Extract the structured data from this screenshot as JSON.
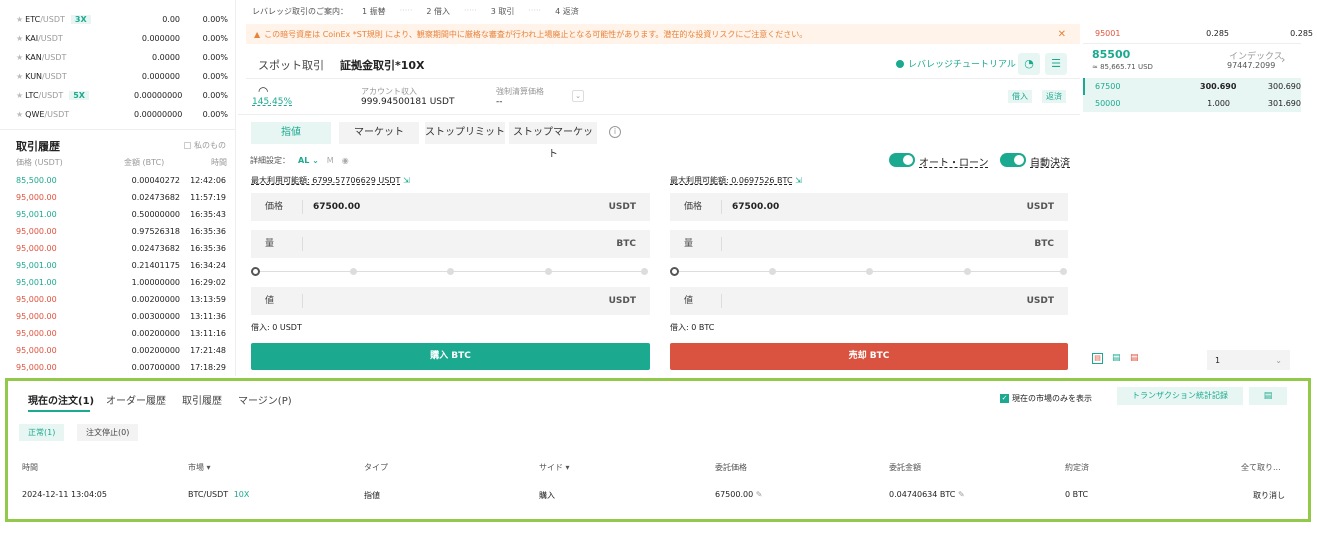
{
  "markets": [
    {
      "name": "ETC",
      "quote": "/USDT",
      "lev": "3X",
      "price": "0.00",
      "change": "0.00%"
    },
    {
      "name": "KAI",
      "quote": "/USDT",
      "lev": "",
      "price": "0.000000",
      "change": "0.00%"
    },
    {
      "name": "KAN",
      "quote": "/USDT",
      "lev": "",
      "price": "0.0000",
      "change": "0.00%"
    },
    {
      "name": "KUN",
      "quote": "/USDT",
      "lev": "",
      "price": "0.000000",
      "change": "0.00%"
    },
    {
      "name": "LTC",
      "quote": "/USDT",
      "lev": "5X",
      "price": "0.00000000",
      "change": "0.00%"
    },
    {
      "name": "QWE",
      "quote": "/USDT",
      "lev": "",
      "price": "0.00000000",
      "change": "0.00%"
    }
  ],
  "trade_history": {
    "title": "取引履歴",
    "mine": "私のもの",
    "h_price": "価格 (USDT)",
    "h_amount": "金額 (BTC)",
    "h_time": "時間",
    "rows": [
      {
        "p": "85,500.00",
        "a": "0.00040272",
        "t": "12:42:06",
        "side": "buy"
      },
      {
        "p": "95,000.00",
        "a": "0.02473682",
        "t": "11:57:19",
        "side": "sell"
      },
      {
        "p": "95,001.00",
        "a": "0.50000000",
        "t": "16:35:43",
        "side": "buy"
      },
      {
        "p": "95,000.00",
        "a": "0.97526318",
        "t": "16:35:36",
        "side": "sell"
      },
      {
        "p": "95,000.00",
        "a": "0.02473682",
        "t": "16:35:36",
        "side": "sell"
      },
      {
        "p": "95,001.00",
        "a": "0.21401175",
        "t": "16:34:24",
        "side": "buy"
      },
      {
        "p": "95,001.00",
        "a": "1.00000000",
        "t": "16:29:02",
        "side": "buy"
      },
      {
        "p": "95,000.00",
        "a": "0.00200000",
        "t": "13:13:59",
        "side": "sell"
      },
      {
        "p": "95,000.00",
        "a": "0.00300000",
        "t": "13:11:36",
        "side": "sell"
      },
      {
        "p": "95,000.00",
        "a": "0.00200000",
        "t": "13:11:16",
        "side": "sell"
      },
      {
        "p": "95,000.00",
        "a": "0.00200000",
        "t": "17:21:48",
        "side": "sell"
      },
      {
        "p": "95,000.00",
        "a": "0.00700000",
        "t": "17:18:29",
        "side": "sell"
      }
    ]
  },
  "guide": {
    "title": "レバレッジ取引のご案内：",
    "steps": [
      "1 振替",
      "2 借入",
      "3 取引",
      "4 返済"
    ]
  },
  "warning": "この暗号資産は CoinEx *ST規則 により、観察期間中に厳格な審査が行われ上場廃止となる可能性があります。潜在的な投資リスクにご注意ください。",
  "mode_tabs": {
    "spot": "スポット取引",
    "margin": "証拠金取引*10X"
  },
  "tutorial": "レバレッジチュートリアル",
  "account": {
    "risk": "145.45%",
    "income_label": "アカウント収入",
    "income_value": "999.94500181 USDT",
    "liq_label": "強制清算価格",
    "liq_value": "--",
    "borrow": "借入",
    "repay": "返済"
  },
  "order_types": [
    "指値",
    "マーケット",
    "ストップリミット",
    "ストップマーケット"
  ],
  "settings": {
    "label": "詳細設定：",
    "al": "AL",
    "m": "M",
    "auto_loan": "オート・ローン",
    "auto_repay": "自動決済"
  },
  "buy": {
    "avail": "最大利用可能額: 6799.57706629 USDT",
    "price_label": "価格",
    "price": "67500.00",
    "price_unit": "USDT",
    "qty_label": "量",
    "qty_unit": "BTC",
    "total_label": "値",
    "total_unit": "USDT",
    "borrow": "借入: 0 USDT",
    "button": "購入 BTC"
  },
  "sell": {
    "avail": "最大利用可能額: 0.0697526 BTC",
    "price_label": "価格",
    "price": "67500.00",
    "price_unit": "USDT",
    "qty_label": "量",
    "qty_unit": "BTC",
    "total_label": "値",
    "total_unit": "USDT",
    "borrow": "借入: 0 BTC",
    "button": "売却 BTC"
  },
  "orderbook": {
    "ask": {
      "p": "95001",
      "a": "0.285",
      "t": "0.285"
    },
    "last": "85500",
    "last_usd": "≈ 85,665.71 USD",
    "index_label": "インデックス",
    "index": "97447.2099",
    "bids": [
      {
        "p": "67500",
        "a": "300.690",
        "t": "300.690"
      },
      {
        "p": "50000",
        "a": "1.000",
        "t": "301.690"
      }
    ],
    "precision": "1"
  },
  "orders": {
    "tabs": [
      "現在の注文(1)",
      "オーダー履歴",
      "取引履歴",
      "マージン(P)"
    ],
    "only_current": "現在の市場のみを表示",
    "stats": "トランザクション統計記録",
    "sub_tabs": [
      "正常(1)",
      "注文停止(0)"
    ],
    "headers": [
      "時間",
      "市場",
      "タイプ",
      "サイド",
      "委託価格",
      "委託金額",
      "約定済",
      "全て取り..."
    ],
    "row": {
      "time": "2024-12-11 13:04:05",
      "market": "BTC/USDT",
      "lev": "10X",
      "type": "指値",
      "side": "購入",
      "price": "67500.00",
      "amount": "0.04740634 BTC",
      "filled": "0 BTC",
      "cancel": "取り消し"
    }
  }
}
